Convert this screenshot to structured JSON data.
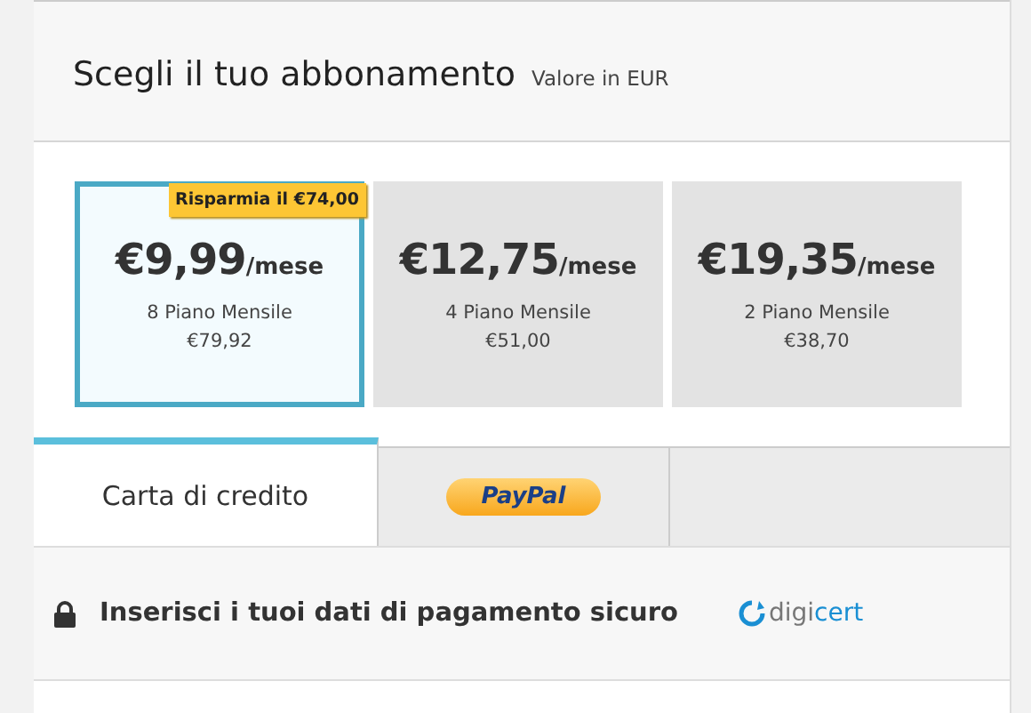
{
  "header": {
    "title": "Scegli il tuo abbonamento",
    "subtitle": "Valore in EUR"
  },
  "plans": [
    {
      "price": "€9,99",
      "unit": "/mese",
      "name": "8 Piano Mensile",
      "total": "€79,92",
      "selected": true,
      "badge": "Risparmia il €74,00"
    },
    {
      "price": "€12,75",
      "unit": "/mese",
      "name": "4 Piano Mensile",
      "total": "€51,00",
      "selected": false
    },
    {
      "price": "€19,35",
      "unit": "/mese",
      "name": "2 Piano Mensile",
      "total": "€38,70",
      "selected": false
    }
  ],
  "tabs": [
    {
      "kind": "text",
      "label": "Carta di credito",
      "selected": true
    },
    {
      "kind": "paypal",
      "label": "PayPal",
      "selected": false
    }
  ],
  "secure_bar": {
    "text": "Inserisci i tuoi dati di pagamento sicuro",
    "seal": "digi**cert**"
  }
}
